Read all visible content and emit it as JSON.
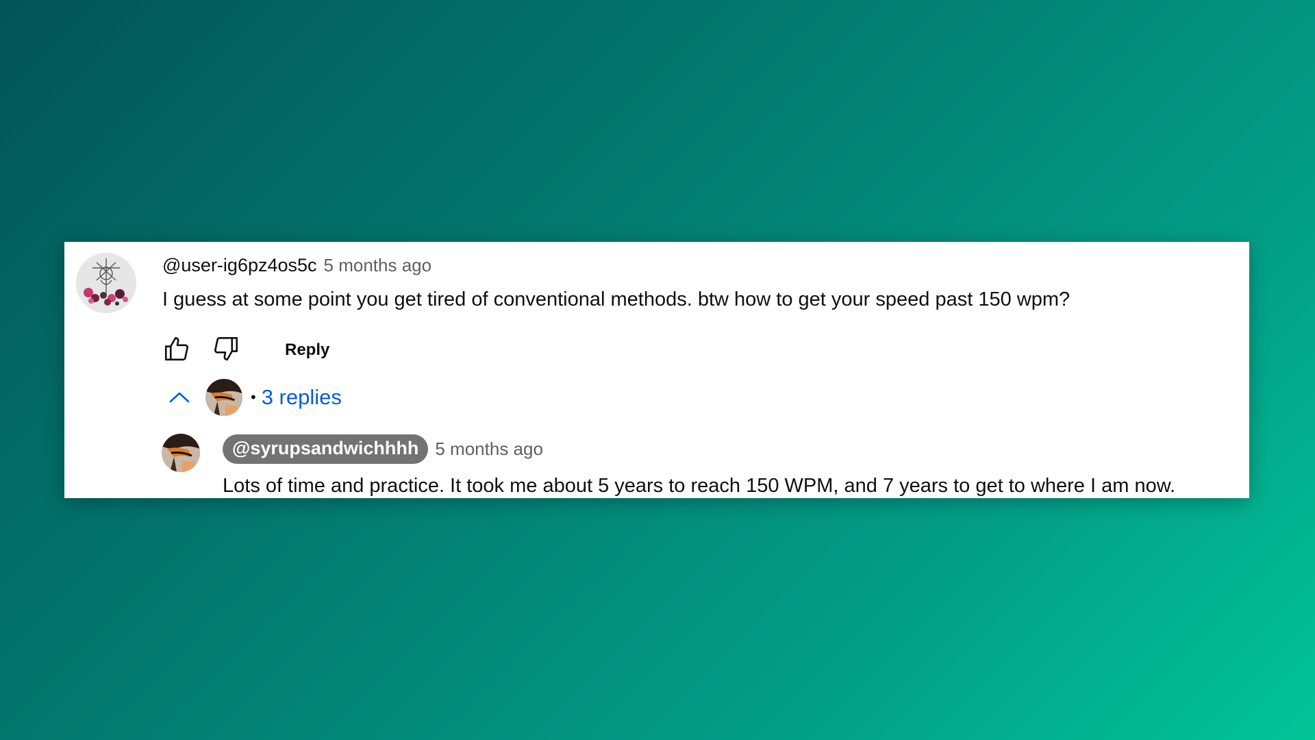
{
  "comment": {
    "author": "@user-ig6pz4os5c",
    "time": "5 months ago",
    "text": "I guess at some point you get tired of conventional methods. btw how to get your speed past 150 wpm?",
    "actions": {
      "like_icon": "thumbs-up-icon",
      "dislike_icon": "thumbs-down-icon",
      "reply_label": "Reply"
    },
    "replies_toggle": {
      "icon": "chevron-up-icon",
      "separator": "•",
      "label": "3 replies"
    }
  },
  "reply": {
    "author": "@syrupsandwichhhh",
    "time": "5 months ago",
    "text": "Lots of time and practice. It took me about 5 years to reach 150 WPM, and 7 years to get to where I am now."
  },
  "colors": {
    "background_gradient_start": "#035459",
    "background_gradient_end": "#02c497",
    "link_blue": "#065fd4",
    "author_chip": "#737373",
    "secondary_text": "#606060"
  }
}
